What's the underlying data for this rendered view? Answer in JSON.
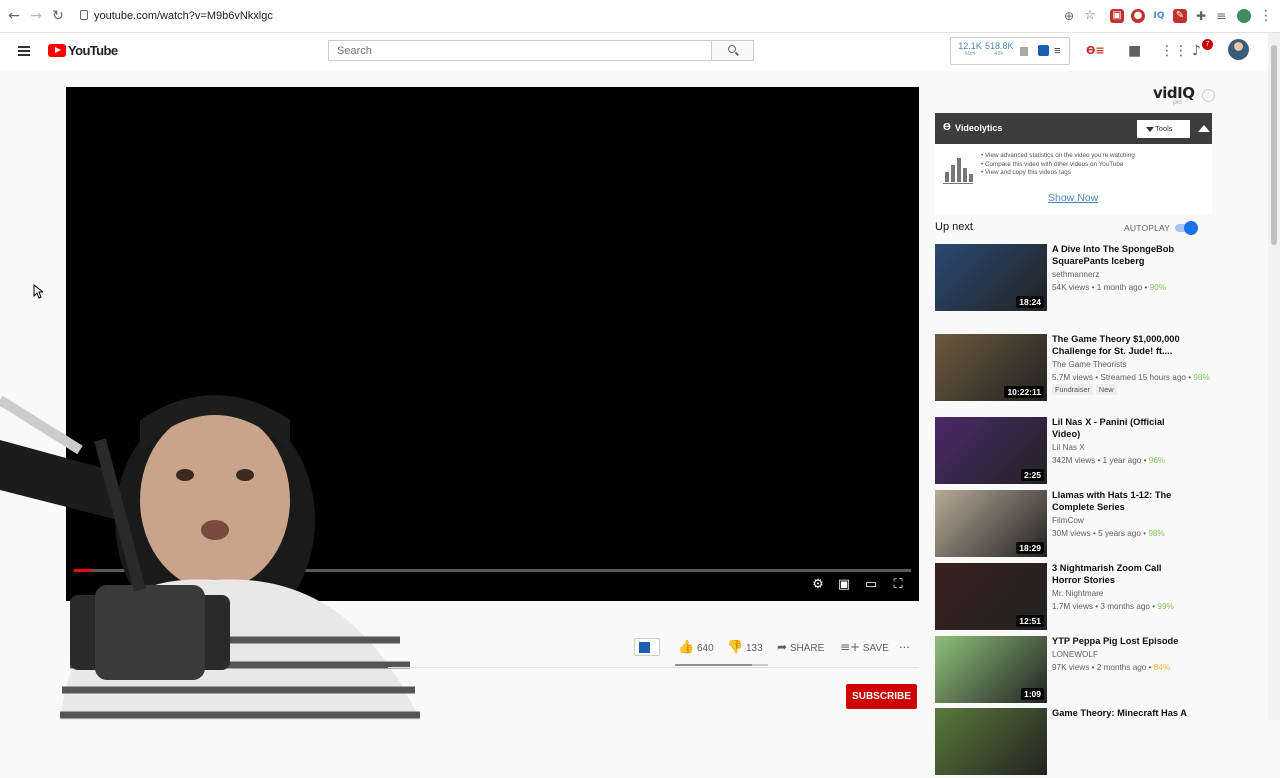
{
  "browser": {
    "url": "youtube.com/watch?v=M9b6vNkxlgc"
  },
  "youtube": {
    "logo": "YouTube",
    "search_placeholder": "Search",
    "notification_count": "7"
  },
  "vidiq_header": {
    "stat1_value": "12.1K",
    "stat1_sub": "60m",
    "stat2_value": "518.8K",
    "stat2_sub": "48h"
  },
  "video": {
    "likes": "640",
    "dislikes": "133",
    "share": "SHARE",
    "save": "SAVE",
    "more": "...",
    "subscribe": "SUBSCRIBE",
    "progress_fraction": 0.02
  },
  "vidiq_panel": {
    "logo": "vidIQ",
    "logo_sub": "pro",
    "title": "Videolytics",
    "tools": "Tools",
    "bullets": [
      "View advanced statistics on the video you're watching",
      "Compare this video with other videos on YouTube",
      "View and copy this videos tags"
    ],
    "show_now": "Show Now"
  },
  "sidebar": {
    "upnext": "Up next",
    "autoplay": "AUTOPLAY",
    "autoplay_on": true,
    "recs": [
      {
        "title": "A Dive Into The SpongeBob SquarePants Iceberg",
        "channel": "sethmannerz",
        "views": "54K views",
        "age": "1 month ago",
        "pct": "90%",
        "duration": "18:24",
        "color": "#2a4a72"
      },
      {
        "title": "The Game Theory $1,000,000 Challenge for St. Jude! ft....",
        "channel": "The Game Theorists",
        "views": "5.7M views",
        "age": "Streamed 15 hours ago",
        "pct": "98%",
        "duration": "10:22:11",
        "tags": [
          "Fundraiser",
          "New"
        ],
        "color": "#6b5a3f"
      },
      {
        "title": "Lil Nas X - Panini (Official Video)",
        "channel": "Lil Nas X",
        "views": "342M views",
        "age": "1 year ago",
        "pct": "96%",
        "duration": "2:25",
        "color": "#4a2a6a"
      },
      {
        "title": "Llamas with Hats 1-12: The Complete Series",
        "channel": "FilmCow",
        "views": "30M views",
        "age": "5 years ago",
        "pct": "98%",
        "duration": "18:29",
        "color": "#b8aa98"
      },
      {
        "title": "3 Nightmarish Zoom Call Horror Stories",
        "channel": "Mr. Nightmare",
        "views": "1.7M views",
        "age": "3 months ago",
        "pct": "99%",
        "duration": "12:51",
        "color": "#3a2020"
      },
      {
        "title": "YTP Peppa Pig Lost Episode",
        "channel": "LONEWOLF",
        "views": "97K views",
        "age": "2 months ago",
        "pct": "84%",
        "duration": "1:09",
        "color": "#8fc07a"
      },
      {
        "title": "Game Theory: Minecraft Has A",
        "channel": "",
        "views": "",
        "age": "",
        "pct": "",
        "duration": "",
        "color": "#5a7a3a"
      }
    ]
  }
}
